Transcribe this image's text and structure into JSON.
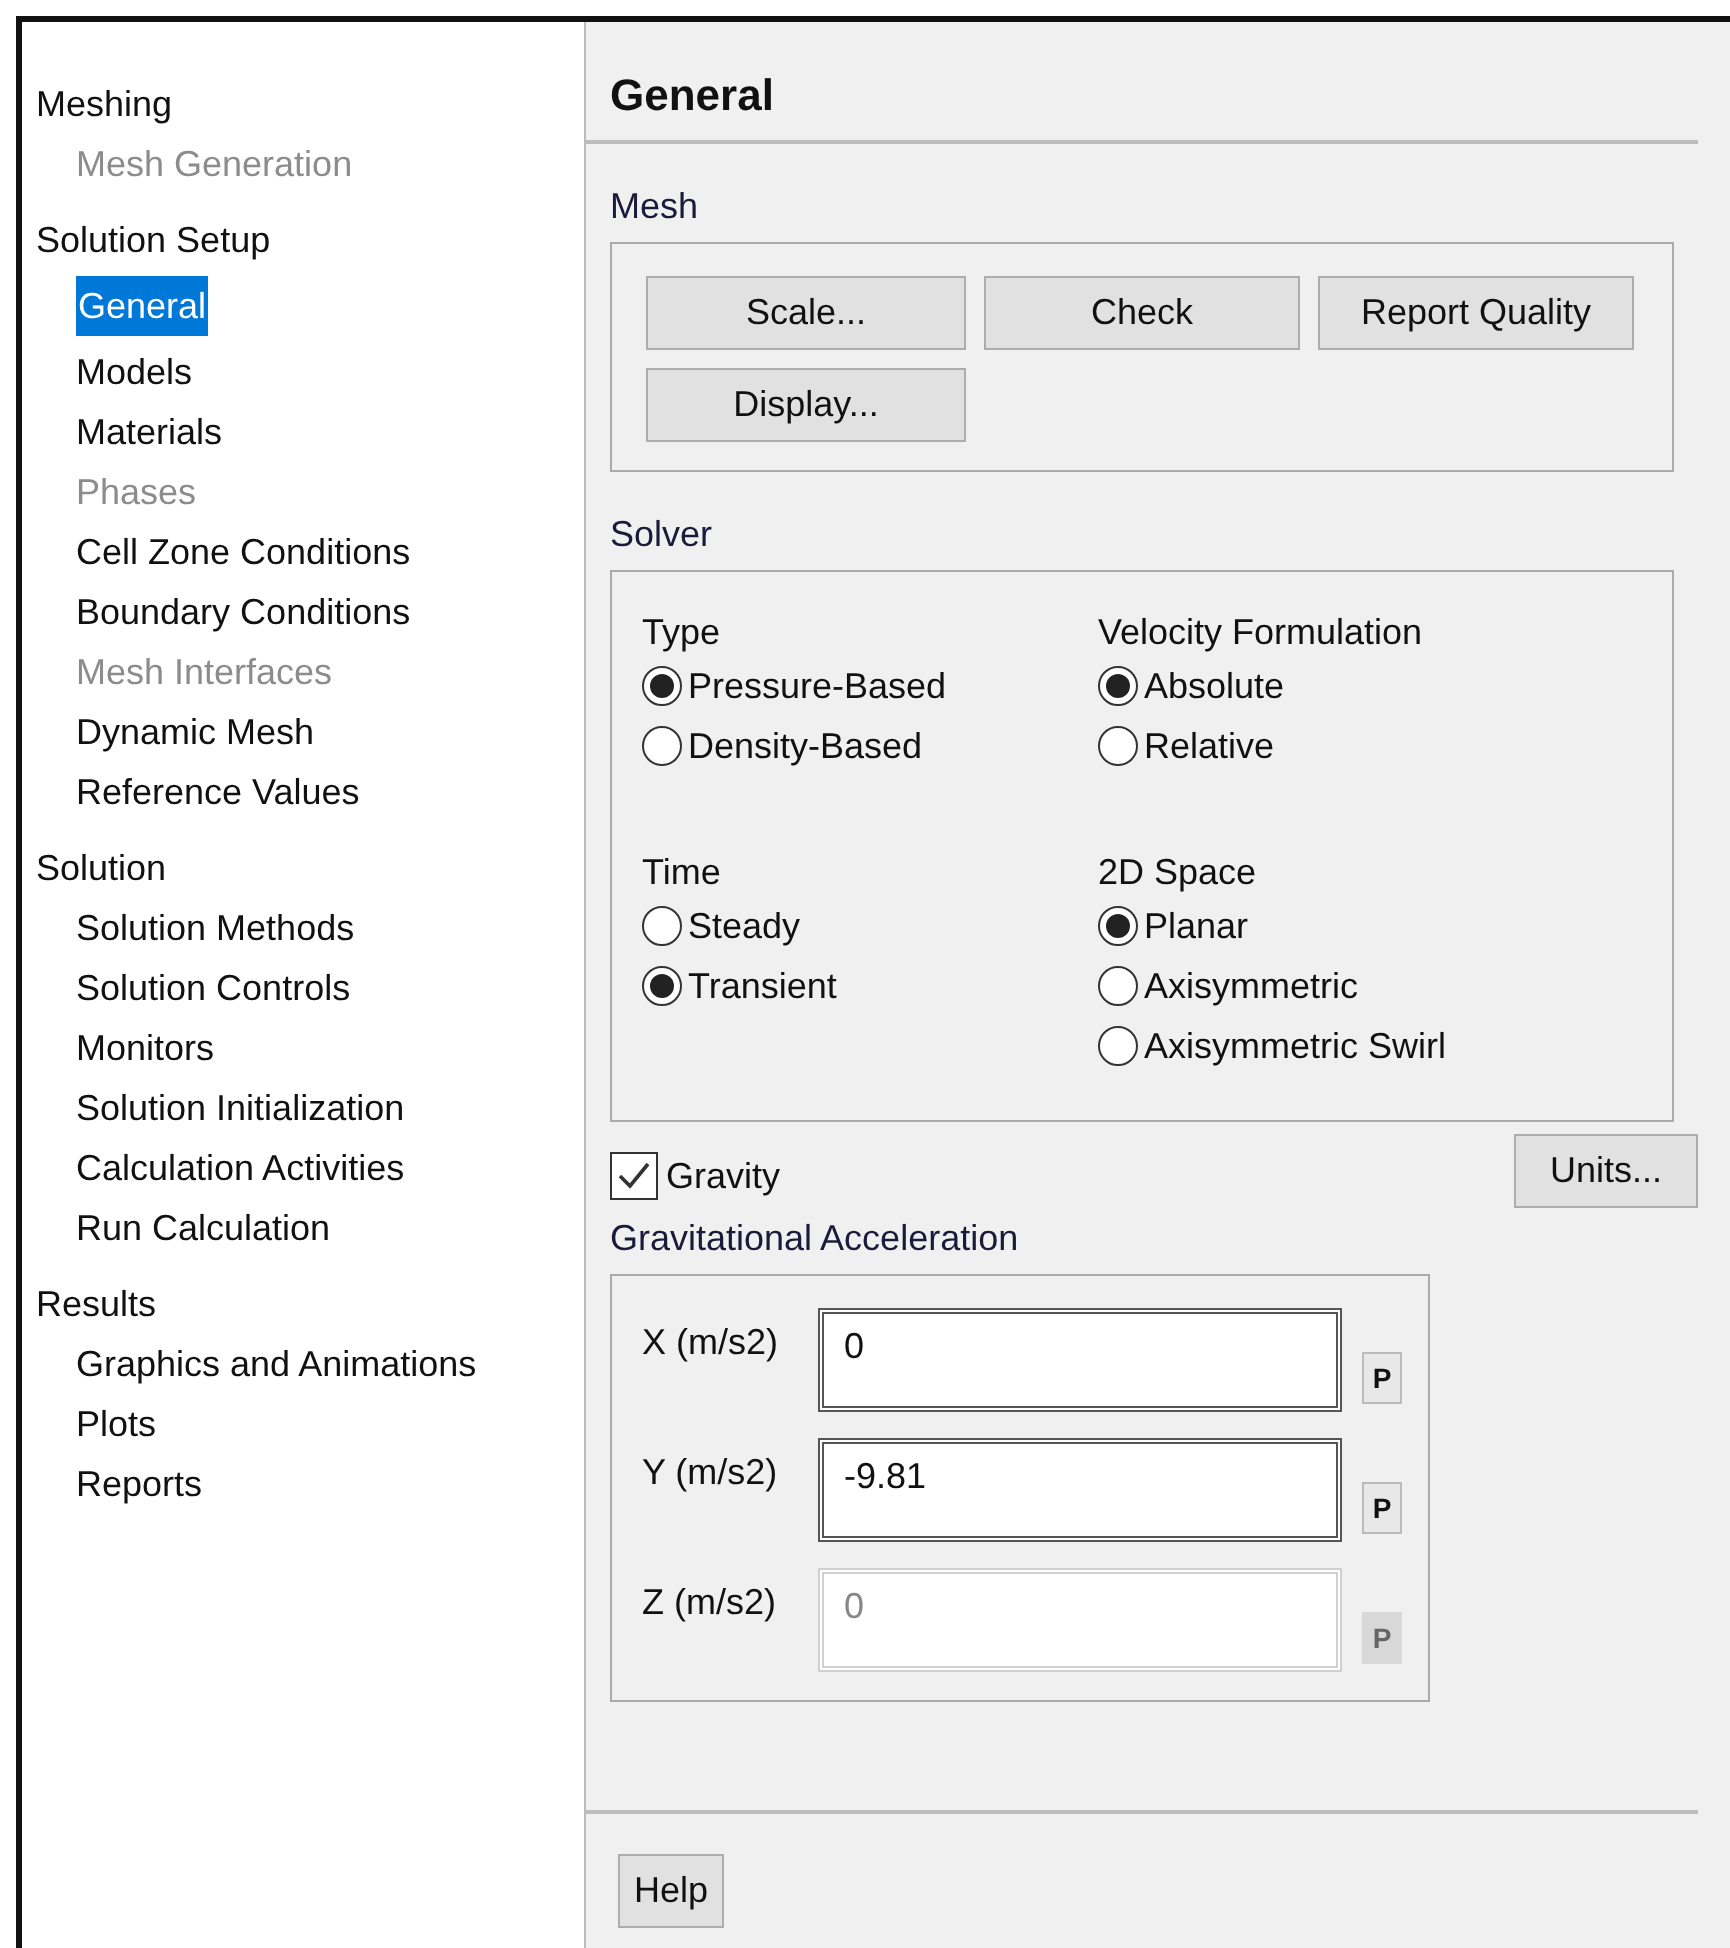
{
  "tree": [
    {
      "label": "Meshing",
      "children": [
        {
          "label": "Mesh Generation",
          "selected": false,
          "disabled": true
        }
      ]
    },
    {
      "label": "Solution Setup",
      "children": [
        {
          "label": "General",
          "selected": true,
          "disabled": false
        },
        {
          "label": "Models",
          "selected": false,
          "disabled": false
        },
        {
          "label": "Materials",
          "selected": false,
          "disabled": false
        },
        {
          "label": "Phases",
          "selected": false,
          "disabled": true
        },
        {
          "label": "Cell Zone Conditions",
          "selected": false,
          "disabled": false
        },
        {
          "label": "Boundary Conditions",
          "selected": false,
          "disabled": false
        },
        {
          "label": "Mesh Interfaces",
          "selected": false,
          "disabled": true
        },
        {
          "label": "Dynamic Mesh",
          "selected": false,
          "disabled": false
        },
        {
          "label": "Reference Values",
          "selected": false,
          "disabled": false
        }
      ]
    },
    {
      "label": "Solution",
      "children": [
        {
          "label": "Solution Methods",
          "selected": false,
          "disabled": false
        },
        {
          "label": "Solution Controls",
          "selected": false,
          "disabled": false
        },
        {
          "label": "Monitors",
          "selected": false,
          "disabled": false
        },
        {
          "label": "Solution Initialization",
          "selected": false,
          "disabled": false
        },
        {
          "label": "Calculation Activities",
          "selected": false,
          "disabled": false
        },
        {
          "label": "Run Calculation",
          "selected": false,
          "disabled": false
        }
      ]
    },
    {
      "label": "Results",
      "children": [
        {
          "label": "Graphics and Animations",
          "selected": false,
          "disabled": false
        },
        {
          "label": "Plots",
          "selected": false,
          "disabled": false
        },
        {
          "label": "Reports",
          "selected": false,
          "disabled": false
        }
      ]
    }
  ],
  "panel": {
    "title": "General",
    "mesh": {
      "label": "Mesh",
      "buttons": [
        "Scale...",
        "Check",
        "Report Quality",
        "Display..."
      ]
    },
    "solver": {
      "label": "Solver",
      "groups": [
        {
          "label": "Type",
          "options": [
            {
              "label": "Pressure-Based",
              "selected": true
            },
            {
              "label": "Density-Based",
              "selected": false
            }
          ]
        },
        {
          "label": "Velocity Formulation",
          "options": [
            {
              "label": "Absolute",
              "selected": true
            },
            {
              "label": "Relative",
              "selected": false
            }
          ]
        },
        {
          "label": "Time",
          "options": [
            {
              "label": "Steady",
              "selected": false
            },
            {
              "label": "Transient",
              "selected": true
            }
          ]
        },
        {
          "label": "2D Space",
          "options": [
            {
              "label": "Planar",
              "selected": true
            },
            {
              "label": "Axisymmetric",
              "selected": false
            },
            {
              "label": "Axisymmetric Swirl",
              "selected": false
            }
          ]
        }
      ]
    },
    "gravity": {
      "label": "Gravity",
      "checked": true
    },
    "units_button": "Units...",
    "acceleration": {
      "label": "Gravitational Acceleration",
      "rows": [
        {
          "label": "X (m/s2)",
          "value": "0",
          "param": "P",
          "disabled": false
        },
        {
          "label": "Y (m/s2)",
          "value": "-9.81",
          "param": "P",
          "disabled": false
        },
        {
          "label": "Z (m/s2)",
          "value": "0",
          "param": "P",
          "disabled": true
        }
      ]
    },
    "help_button": "Help"
  }
}
